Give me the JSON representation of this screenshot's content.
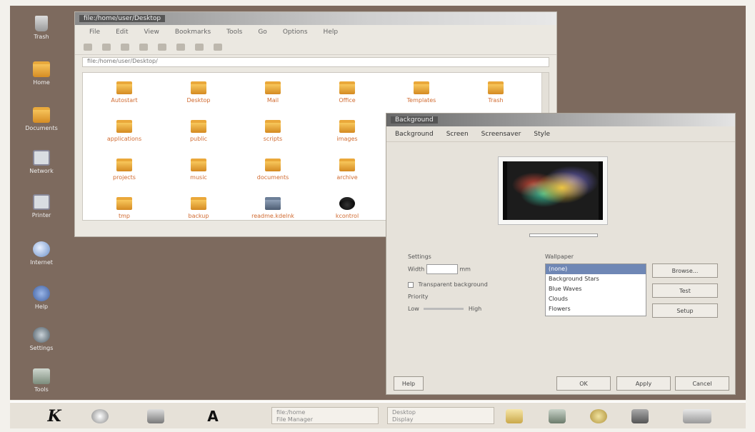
{
  "desktop": {
    "icons": [
      {
        "label": "Trash",
        "glyph": "trash-icon"
      },
      {
        "label": "Home",
        "glyph": "folder-icon"
      },
      {
        "label": "Documents",
        "glyph": "folder-icon"
      },
      {
        "label": "Network",
        "glyph": "monitor-icon"
      },
      {
        "label": "Printer",
        "glyph": "monitor-icon"
      },
      {
        "label": "Internet",
        "glyph": "globe-icon"
      },
      {
        "label": "Help",
        "glyph": "help-icon"
      },
      {
        "label": "Settings",
        "glyph": "settings-icon"
      },
      {
        "label": "Tools",
        "glyph": "hand-icon"
      }
    ]
  },
  "file_manager": {
    "title": "file:/home/user/Desktop",
    "menu": [
      "File",
      "Edit",
      "View",
      "Bookmarks",
      "Tools",
      "Go",
      "Options",
      "Help"
    ],
    "location": "file:/home/user/Desktop/",
    "items": [
      {
        "label": "Autostart",
        "type": "folder"
      },
      {
        "label": "Desktop",
        "type": "folder"
      },
      {
        "label": "Mail",
        "type": "folder"
      },
      {
        "label": "Office",
        "type": "folder"
      },
      {
        "label": "Templates",
        "type": "folder"
      },
      {
        "label": "Trash",
        "type": "folder"
      },
      {
        "label": "applications",
        "type": "folder"
      },
      {
        "label": "public",
        "type": "folder"
      },
      {
        "label": "scripts",
        "type": "folder"
      },
      {
        "label": "images",
        "type": "folder"
      },
      {
        "label": "",
        "type": "blank"
      },
      {
        "label": "",
        "type": "blank"
      },
      {
        "label": "projects",
        "type": "folder"
      },
      {
        "label": "music",
        "type": "folder"
      },
      {
        "label": "documents",
        "type": "folder"
      },
      {
        "label": "archive",
        "type": "folder"
      },
      {
        "label": "",
        "type": "blank"
      },
      {
        "label": "",
        "type": "blank"
      },
      {
        "label": "tmp",
        "type": "folder"
      },
      {
        "label": "backup",
        "type": "folder"
      },
      {
        "label": "readme.kdelnk",
        "type": "doc"
      },
      {
        "label": "kcontrol",
        "type": "dark"
      },
      {
        "label": "",
        "type": "blank"
      },
      {
        "label": "",
        "type": "blank"
      }
    ]
  },
  "dialog": {
    "title": "Background",
    "toolbar": [
      "Background",
      "Screen",
      "Screensaver",
      "Style"
    ],
    "group_settings": "Settings",
    "width_label": "Width",
    "width_unit": "mm",
    "check_label": "Transparent background",
    "group_priority": "Priority",
    "priority_low": "Low",
    "priority_high": "High",
    "list_title": "Wallpaper",
    "list_items": [
      "(none)",
      "Background Stars",
      "Blue Waves",
      "Clouds",
      "Flowers"
    ],
    "btn_browse": "Browse...",
    "btn_test": "Test",
    "btn_setup": "Setup",
    "btn_help": "Help",
    "btn_ok": "OK",
    "btn_apply": "Apply",
    "btn_cancel": "Cancel"
  },
  "taskbar": {
    "k_label": "K",
    "a_label": "A",
    "tasks": [
      {
        "line1": "file:/home",
        "line2": "File Manager"
      },
      {
        "line1": "Desktop",
        "line2": "Display"
      }
    ]
  },
  "colors": {
    "desktop_bg": "#7d6a5e",
    "folder": "#e0a13a",
    "selection": "#6f87b5"
  }
}
